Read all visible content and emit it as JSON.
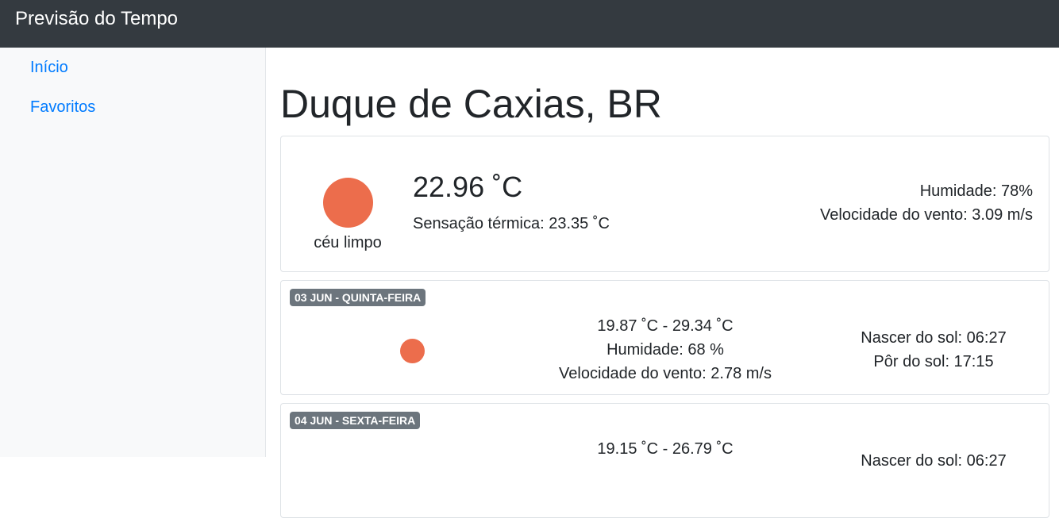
{
  "app": {
    "title": "Previsão do Tempo"
  },
  "sidebar": {
    "items": [
      {
        "label": "Início"
      },
      {
        "label": "Favoritos"
      }
    ]
  },
  "city": "Duque de Caxias, BR",
  "current": {
    "temperature": "22.96 ˚C",
    "feels_like": "Sensação térmica: 23.35 ˚C",
    "condition": "céu limpo",
    "icon": "sun-icon",
    "humidity": "Humidade: 78%",
    "wind": "Velocidade do vento: 3.09 m/s"
  },
  "forecast": [
    {
      "date": "03 JUN - QUINTA-FEIRA",
      "icon": "sun-icon",
      "temp_range": "19.87 ˚C - 29.34 ˚C",
      "humidity": "Humidade: 68 %",
      "wind": "Velocidade do vento: 2.78 m/s",
      "sunrise": "Nascer do sol: 06:27",
      "sunset": "Pôr do sol: 17:15"
    },
    {
      "date": "04 JUN - SEXTA-FEIRA",
      "icon": "sun-icon",
      "temp_range": "19.15 ˚C - 26.79 ˚C",
      "sunrise": "Nascer do sol: 06:27"
    }
  ],
  "colors": {
    "navbar": "#343a40",
    "link": "#007bff",
    "sun": "#ec6d4c",
    "badge": "#6c757d"
  }
}
